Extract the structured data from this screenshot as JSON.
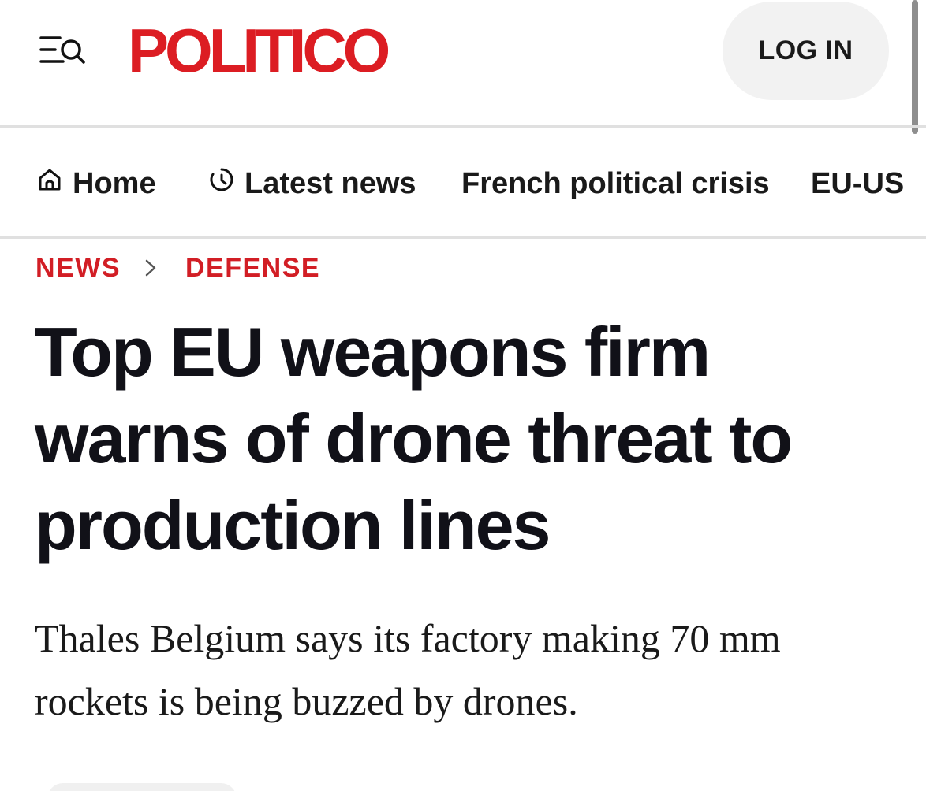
{
  "header": {
    "logo": "POLITICO",
    "login_label": "LOG IN",
    "brand_color": "#dc1d23"
  },
  "nav": {
    "items": [
      {
        "label": "Home",
        "icon": "home-icon"
      },
      {
        "label": "Latest news",
        "icon": "clock-icon"
      },
      {
        "label": "French political crisis"
      },
      {
        "label": "EU-US"
      }
    ]
  },
  "breadcrumb": {
    "items": [
      "NEWS",
      "DEFENSE"
    ],
    "separator_icon": "chevron-right-icon"
  },
  "article": {
    "headline": "Top EU weapons firm warns of drone threat to production lines",
    "dek": "Thales Belgium says its factory making 70 mm rockets is being buzzed by drones."
  }
}
